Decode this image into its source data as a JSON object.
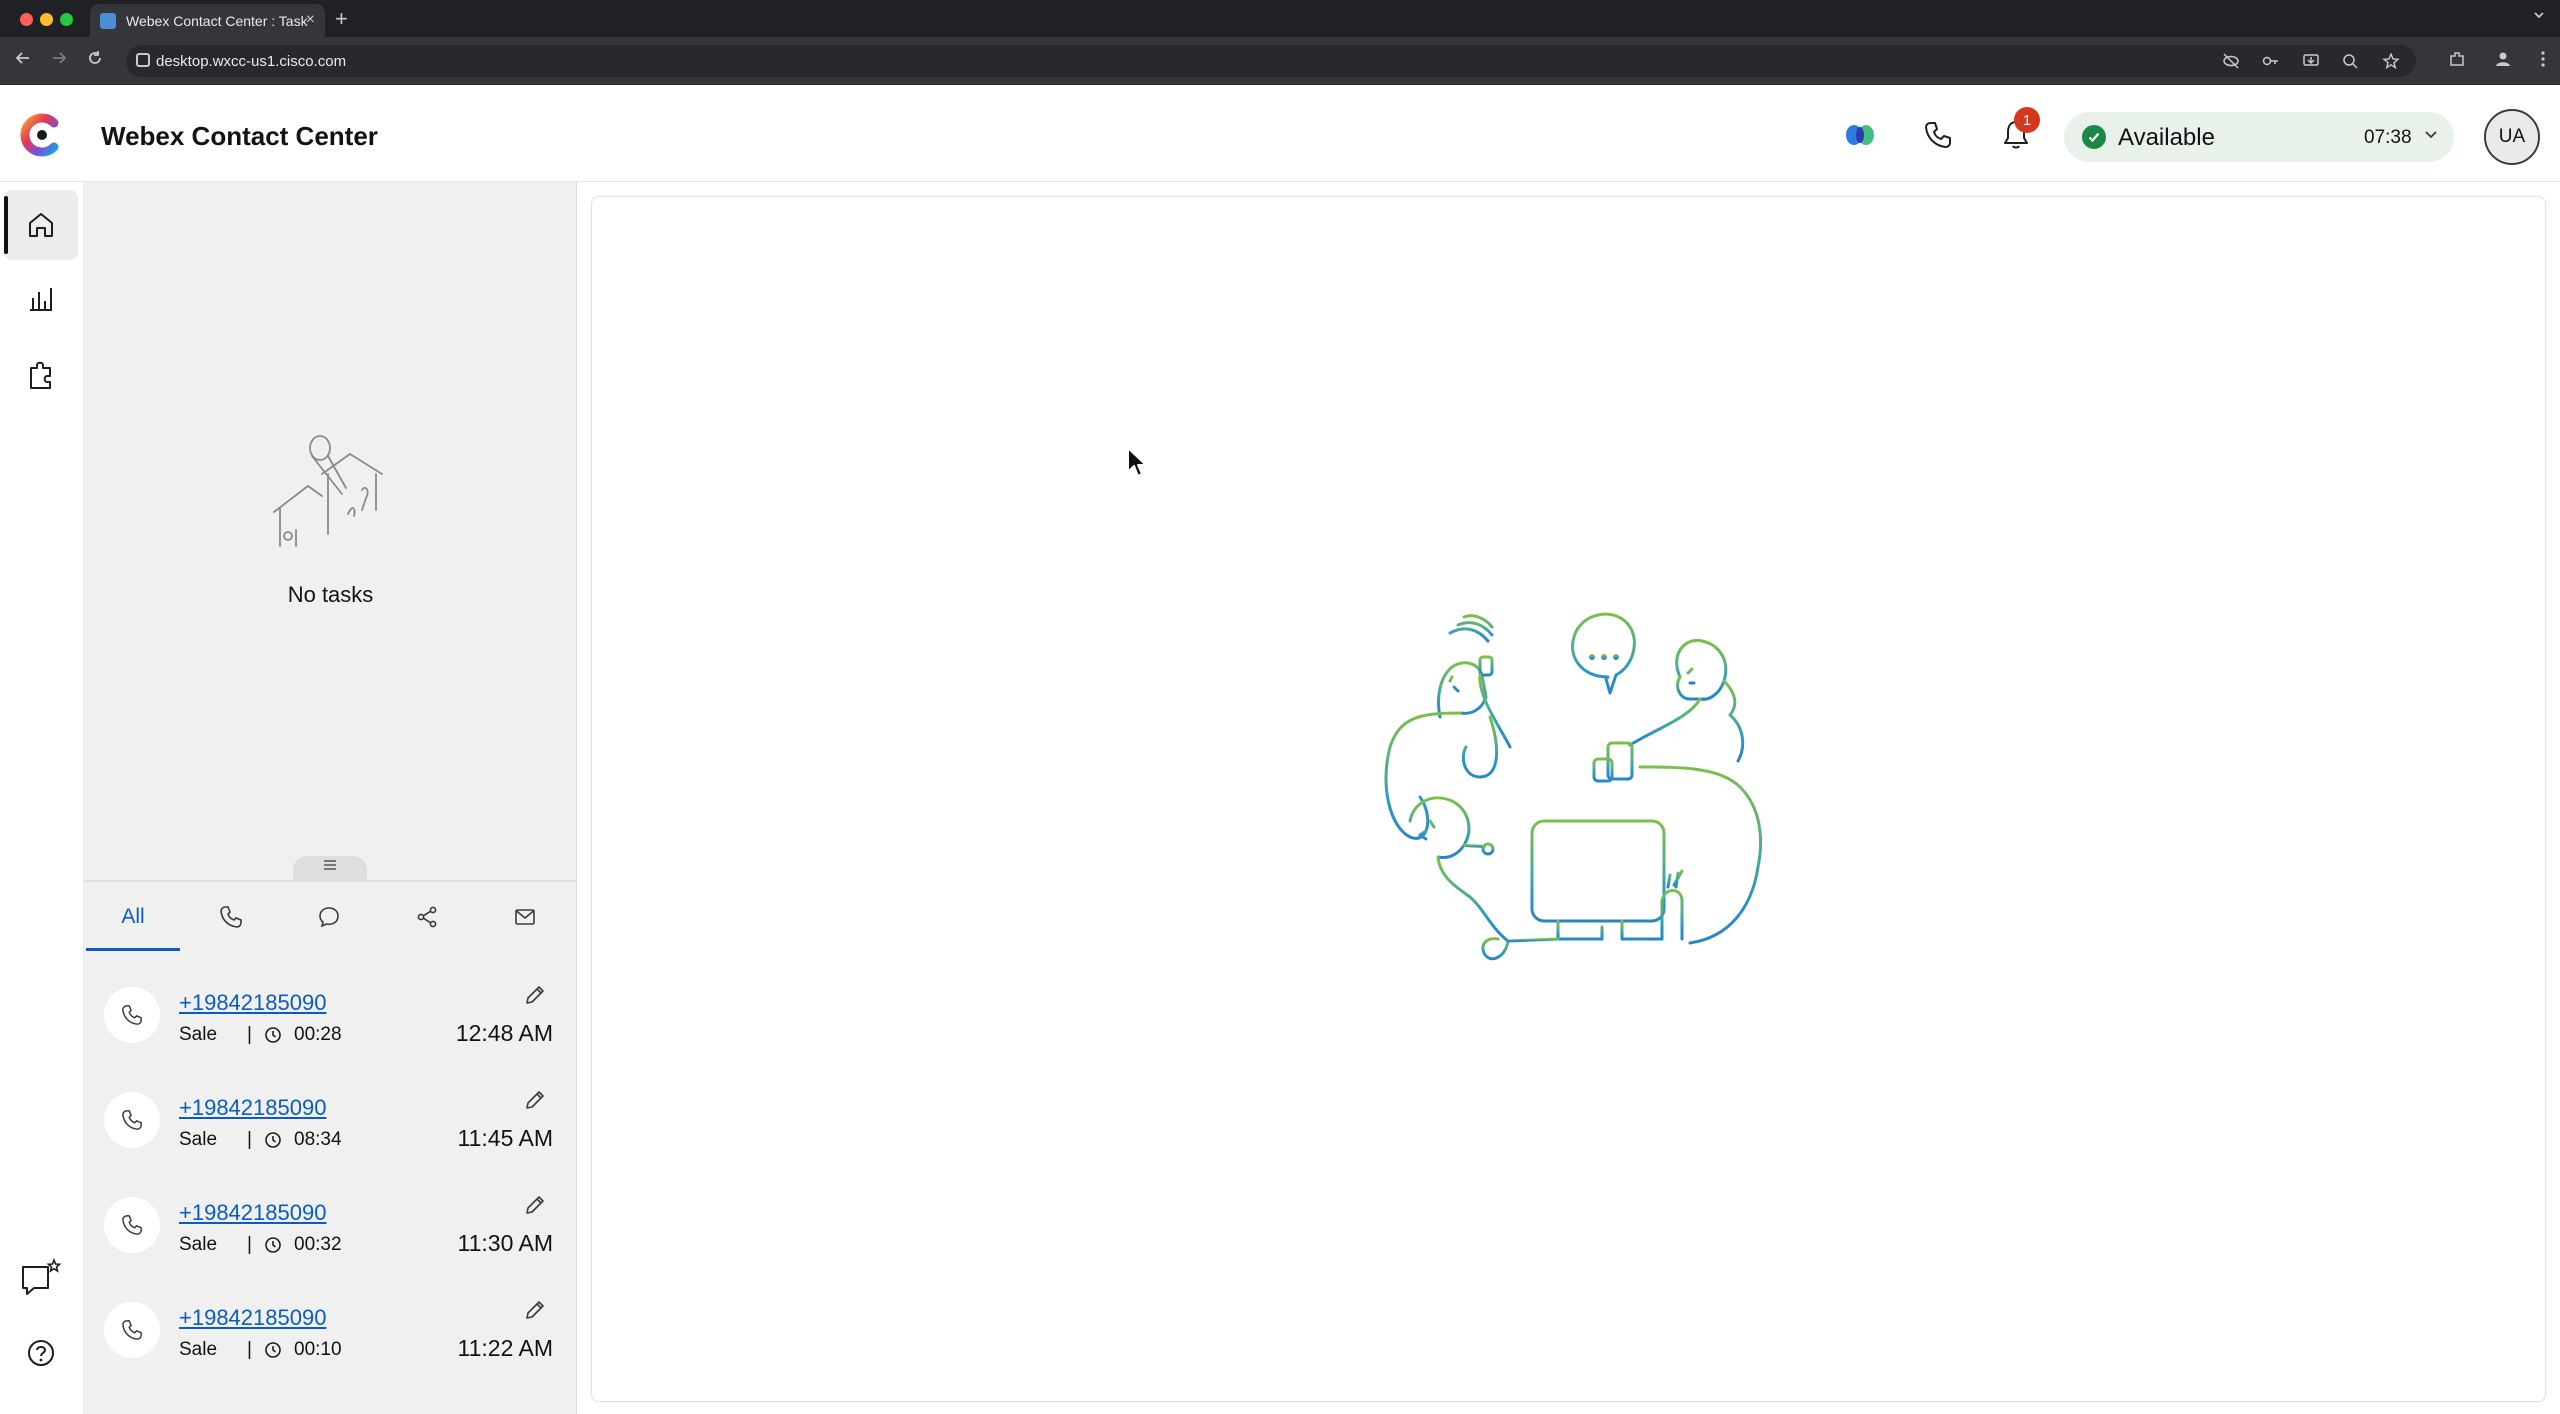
{
  "browser": {
    "tab_title": "Webex Contact Center : Task",
    "url": "desktop.wxcc-us1.cisco.com",
    "new_tab_symbol": "+",
    "tab_close_symbol": "×"
  },
  "header": {
    "app_title": "Webex Contact Center",
    "notification_count": "1",
    "status_label": "Available",
    "status_timer": "07:38",
    "avatar_initials": "UA"
  },
  "task_pane": {
    "empty_text": "No tasks",
    "filter_tabs": [
      {
        "label": "All",
        "active": true
      },
      {
        "icon": "phone-icon"
      },
      {
        "icon": "chat-icon"
      },
      {
        "icon": "social-icon"
      },
      {
        "icon": "email-icon"
      }
    ],
    "history": [
      {
        "number": "+19842185090",
        "queue": "Sale",
        "separator": "|",
        "duration": "00:28",
        "time": "12:48 AM"
      },
      {
        "number": "+19842185090",
        "queue": "Sale",
        "separator": "|",
        "duration": "08:34",
        "time": "11:45 AM"
      },
      {
        "number": "+19842185090",
        "queue": "Sale",
        "separator": "|",
        "duration": "00:32",
        "time": "11:30 AM"
      },
      {
        "number": "+19842185090",
        "queue": "Sale",
        "separator": "|",
        "duration": "00:10",
        "time": "11:22 AM"
      }
    ]
  },
  "colors": {
    "accent_blue": "#0a5cbf",
    "available_green": "#1d8846",
    "badge_red": "#d4371c",
    "illustration_green": "#7cbf4a",
    "illustration_blue": "#2a95c8"
  }
}
